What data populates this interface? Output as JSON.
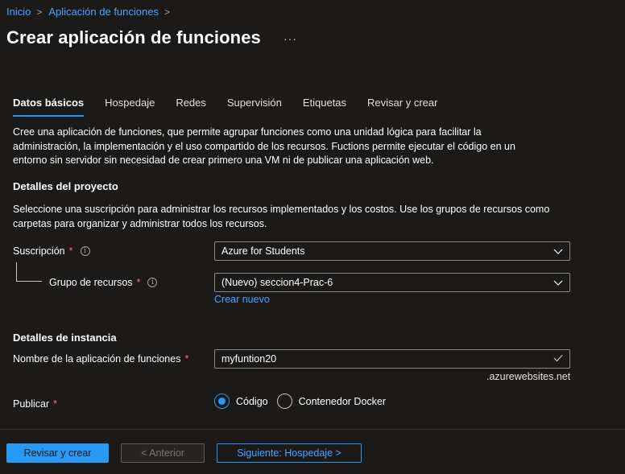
{
  "breadcrumb": {
    "items": [
      {
        "label": "Inicio"
      },
      {
        "label": "Aplicación de funciones"
      }
    ],
    "separator": ">"
  },
  "page": {
    "title": "Crear aplicación de funciones",
    "more": "···"
  },
  "tabs": [
    {
      "label": "Datos básicos",
      "active": true
    },
    {
      "label": "Hospedaje",
      "active": false
    },
    {
      "label": "Redes",
      "active": false
    },
    {
      "label": "Supervisión",
      "active": false
    },
    {
      "label": "Etiquetas",
      "active": false
    },
    {
      "label": "Revisar y crear",
      "active": false
    }
  ],
  "intro": {
    "line1": "Cree una aplicación de funciones, que permite agrupar funciones como una unidad lógica para facilitar la",
    "line2": "administración, la implementación y el uso compartido de los recursos. Fuctions permite ejecutar el código en un",
    "line3": "entorno sin servidor sin necesidad de crear primero una VM ni de publicar una aplicación web."
  },
  "project": {
    "heading": "Detalles del proyecto",
    "desc_line1": "Seleccione una suscripción para administrar los recursos implementados y los costos. Use los grupos de recursos como",
    "desc_line2": "carpetas para organizar y administrar todos los recursos.",
    "subscription_label": "Suscripción",
    "subscription_value": "Azure for Students",
    "resource_group_label": "Grupo de recursos",
    "resource_group_value": "(Nuevo) seccion4-Prac-6",
    "create_new": "Crear nuevo",
    "required_mark": "*",
    "info_glyph": "i"
  },
  "instance": {
    "heading": "Detalles de instancia",
    "name_label": "Nombre de la aplicación de funciones",
    "name_value": "myfuntion20",
    "name_suffix": ".azurewebsites.net",
    "publish_label": "Publicar",
    "publish_options": [
      {
        "label": "Código",
        "checked": true
      },
      {
        "label": "Contenedor Docker",
        "checked": false
      }
    ],
    "required_mark": "*"
  },
  "footer": {
    "review_create": "Revisar y crear",
    "previous": "< Anterior",
    "next": "Siguiente: Hospedaje >"
  },
  "colors": {
    "background": "#1b1a19",
    "accent": "#2899f5",
    "link": "#4aa3ff",
    "required": "#f1707b",
    "valid_check": "#c8c6c4"
  }
}
